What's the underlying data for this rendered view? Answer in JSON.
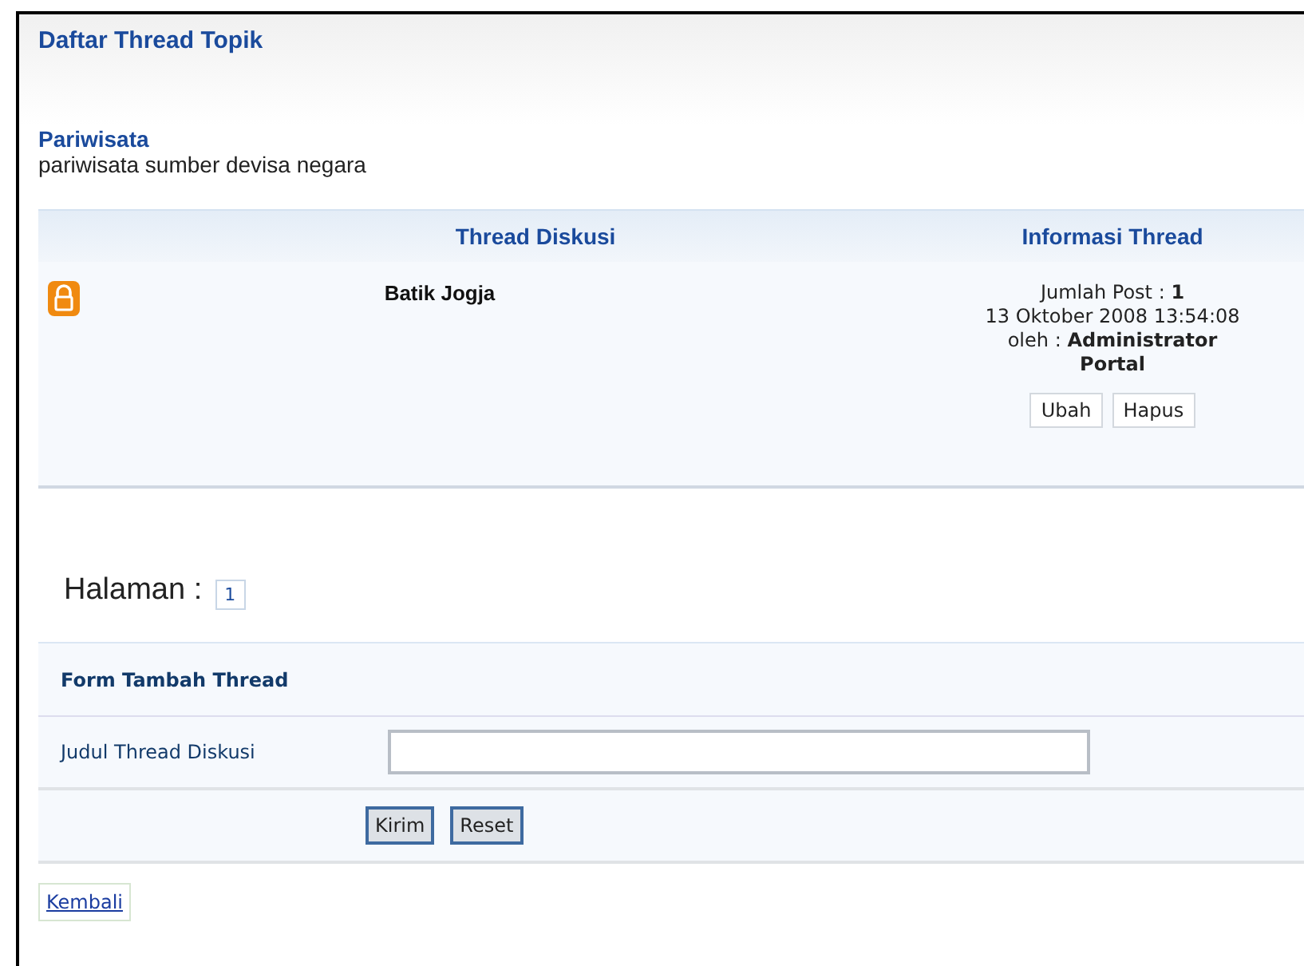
{
  "page_title": "Daftar Thread Topik",
  "topic": {
    "name": "Pariwisata",
    "description": "pariwisata sumber devisa negara"
  },
  "table": {
    "columns": [
      "Thread Diskusi",
      "Informasi Thread"
    ],
    "rows": [
      {
        "locked": true,
        "title": "Batik Jogja",
        "post_count": "Jumlah Post : **1**",
        "date": "13 Oktober 2008 13:54:08",
        "author": "oleh : **Administrator Portal**",
        "actions": [
          "Ubah",
          "Hapus"
        ]
      }
    ]
  },
  "pagination": {
    "label": "Halaman :",
    "pages": [
      {
        "label": "1",
        "selected": true
      }
    ]
  },
  "form": {
    "title": "Form Tambah Thread",
    "field_label": "Judul Thread Diskusi",
    "buttons": [
      "Kirim",
      "Reset"
    ]
  },
  "back_link": "Kembali"
}
